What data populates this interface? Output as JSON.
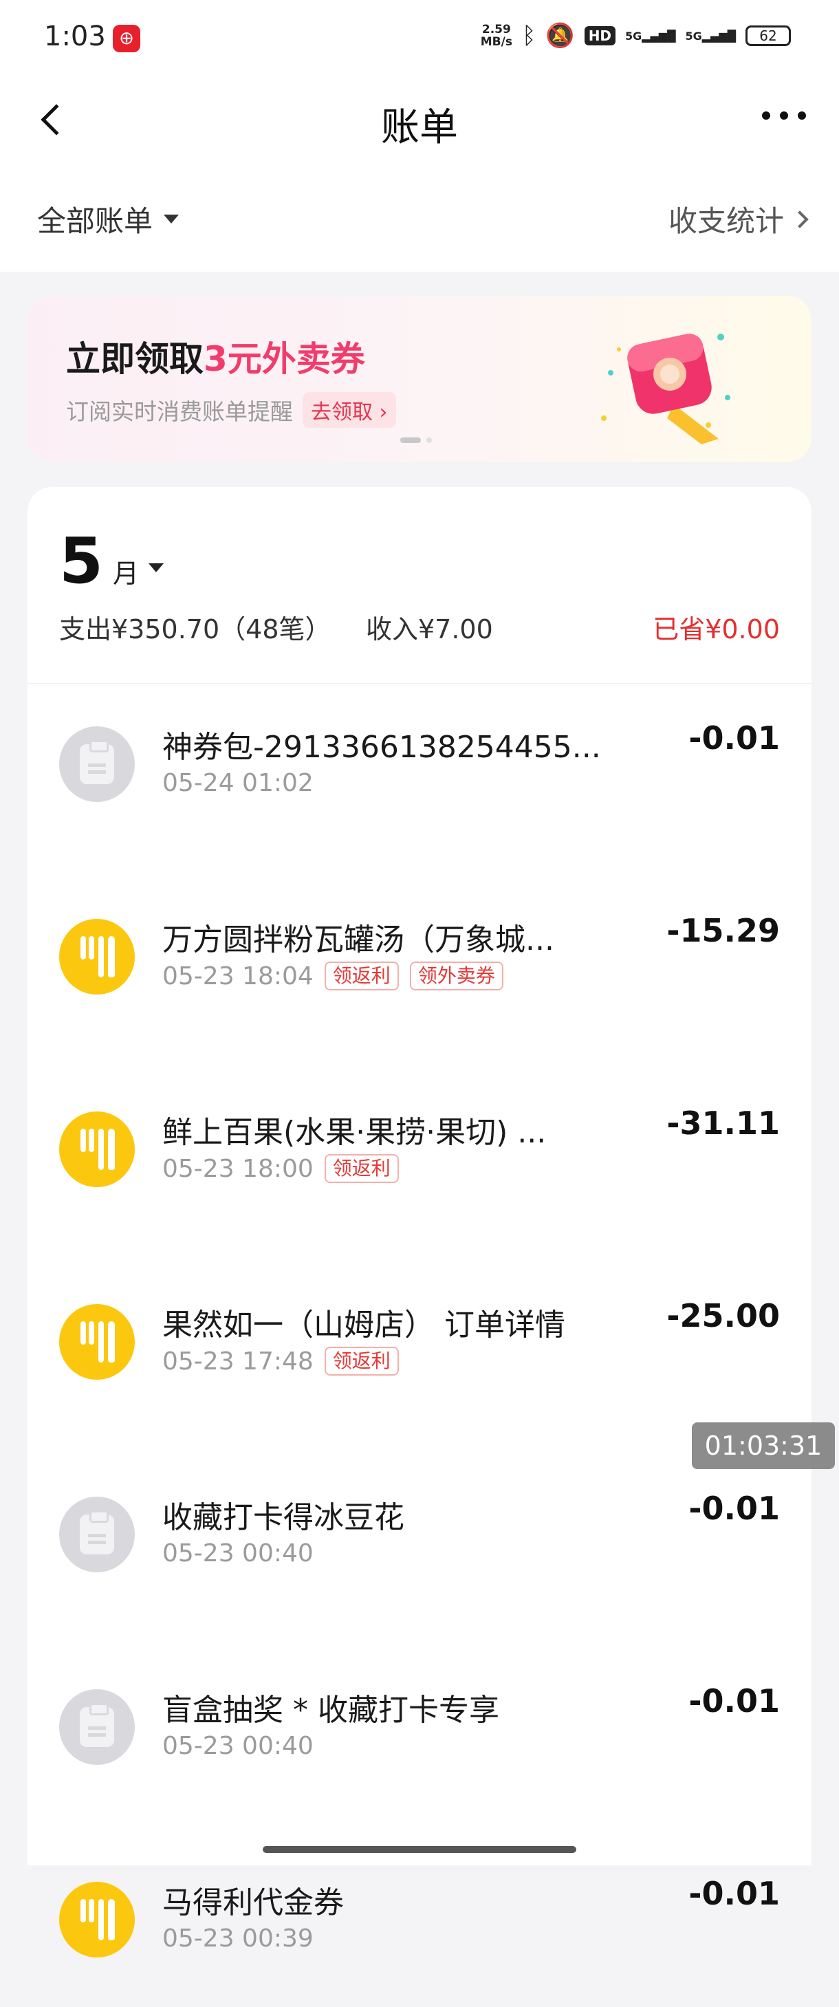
{
  "status_bar": {
    "time": "1:03",
    "network_speed_value": "2.59",
    "network_speed_unit": "MB/s",
    "hd_label": "HD",
    "signal1": "5G",
    "signal2": "5G",
    "battery": "62"
  },
  "nav": {
    "title": "账单"
  },
  "filter": {
    "all_label": "全部账单",
    "stats_label": "收支统计"
  },
  "banner": {
    "title_prefix": "立即领取",
    "title_highlight": "3元外卖券",
    "subtitle": "订阅实时消费账单提醒",
    "cta": "去领取 ›"
  },
  "month": {
    "number": "5",
    "unit": "月",
    "expense": "支出¥350.70（48笔）",
    "income": "收入¥7.00",
    "saved": "已省¥0.00"
  },
  "transactions": [
    {
      "name": "神券包-2913366138254455...",
      "time": "05-24 01:02",
      "amount": "-0.01",
      "icon": "clipboard-icon",
      "tags": []
    },
    {
      "name": "万方圆拌粉瓦罐汤（万象城...",
      "time": "05-23 18:04",
      "amount": "-15.29",
      "icon": "food-icon",
      "tags": [
        "领返利",
        "领外卖券"
      ]
    },
    {
      "name": "鲜上百果(水果·果捞·果切) ...",
      "time": "05-23 18:00",
      "amount": "-31.11",
      "icon": "food-icon",
      "tags": [
        "领返利"
      ]
    },
    {
      "name": "果然如一（山姆店） 订单详情",
      "time": "05-23 17:48",
      "amount": "-25.00",
      "icon": "food-icon",
      "tags": [
        "领返利"
      ]
    },
    {
      "name": "收藏打卡得冰豆花",
      "time": "05-23 00:40",
      "amount": "-0.01",
      "icon": "clipboard-icon",
      "tags": []
    },
    {
      "name": "盲盒抽奖 * 收藏打卡专享",
      "time": "05-23 00:40",
      "amount": "-0.01",
      "icon": "clipboard-icon",
      "tags": []
    },
    {
      "name": "马得利代金券",
      "time": "05-23 00:39",
      "amount": "-0.01",
      "icon": "food-icon",
      "tags": []
    }
  ],
  "overlay_timestamp": "01:03:31",
  "colors": {
    "accent_red": "#e62e2e",
    "food_yellow": "#fcc80f",
    "banner_pink": "#f23c6c"
  }
}
